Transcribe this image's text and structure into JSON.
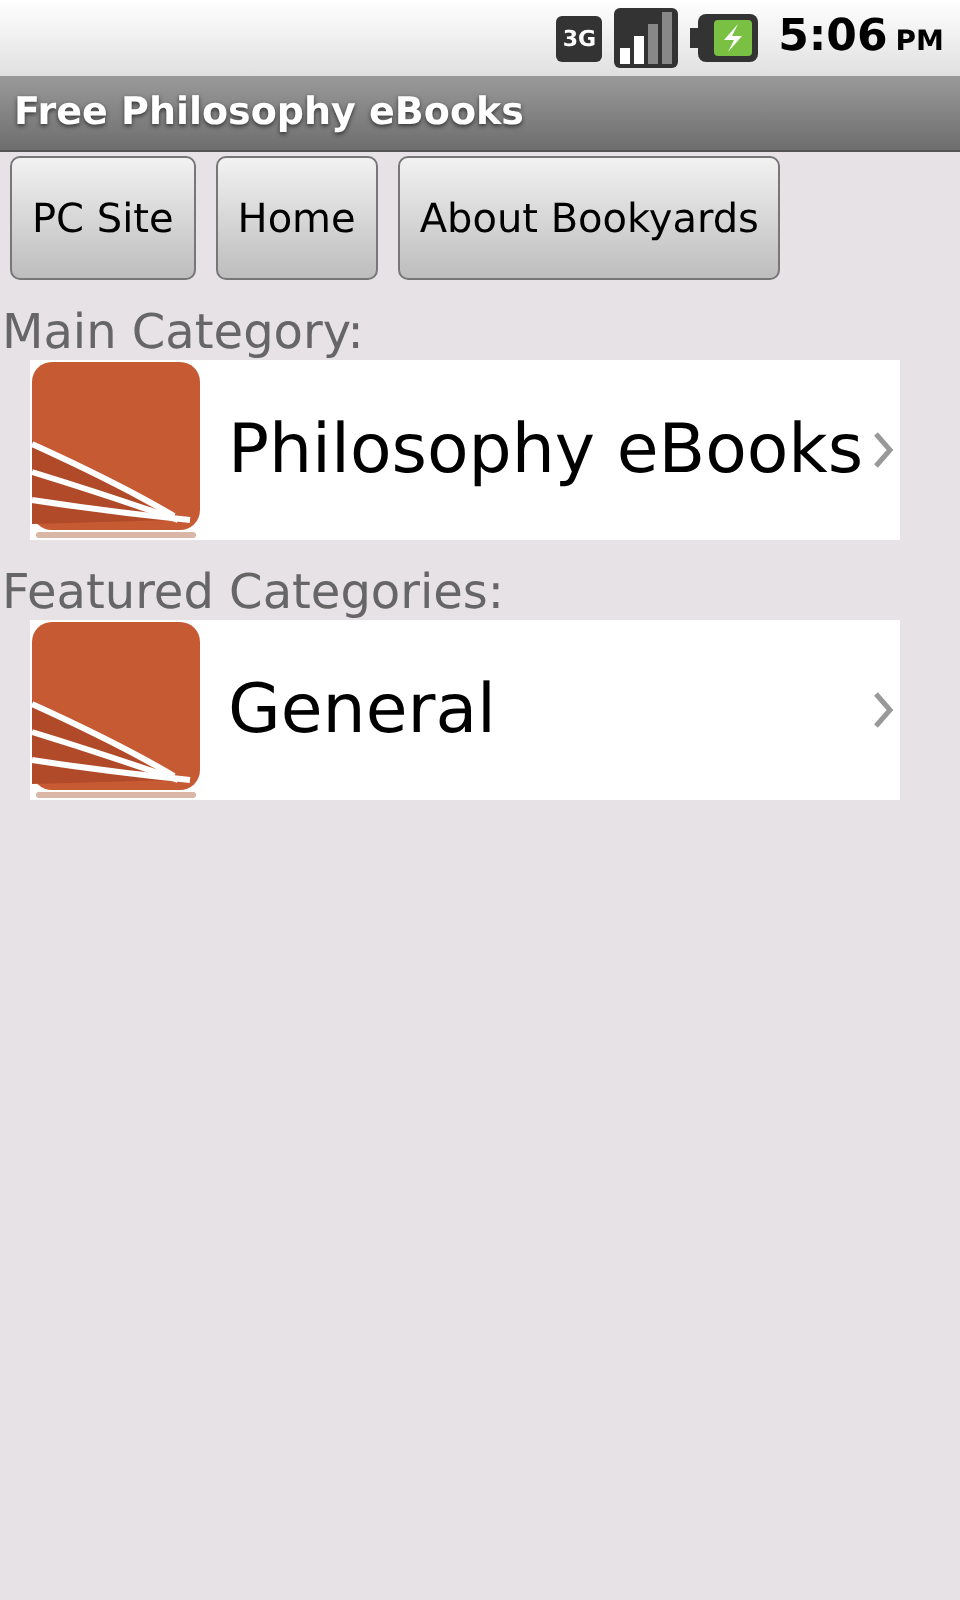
{
  "status_bar": {
    "network": "3G",
    "time": "5:06",
    "period": "PM"
  },
  "title": "Free Philosophy eBooks",
  "nav_buttons": [
    "PC Site",
    "Home",
    "About Bookyards"
  ],
  "sections": [
    {
      "heading": "Main Category:",
      "items": [
        {
          "label": "Philosophy eBooks"
        }
      ]
    },
    {
      "heading": "Featured Categories:",
      "items": [
        {
          "label": "General"
        }
      ]
    }
  ]
}
